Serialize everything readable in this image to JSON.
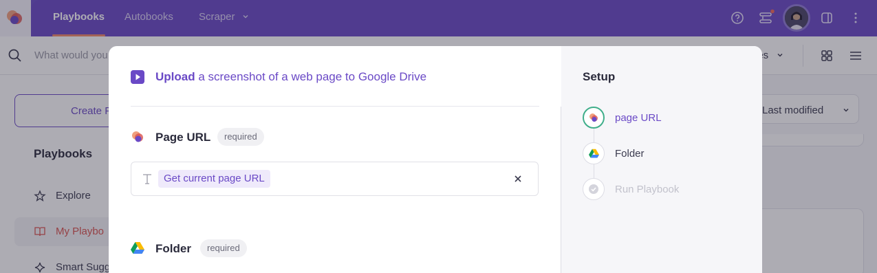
{
  "topnav": {
    "tabs": [
      {
        "label": "Playbooks",
        "active": true
      },
      {
        "label": "Autobooks",
        "active": false
      },
      {
        "label": "Scraper",
        "active": false,
        "has_dropdown": true
      }
    ],
    "icons": [
      "help-icon",
      "workflows-icon",
      "avatar",
      "sidebar-toggle-icon",
      "more-vertical-icon"
    ]
  },
  "background": {
    "search_placeholder": "What would you",
    "filter_label_partial": "ies",
    "create_button_label": "Create P",
    "sidebar_title": "Playbooks",
    "sidebar_items": [
      {
        "label": "Explore",
        "icon": "star-icon"
      },
      {
        "label": "My Playbo",
        "icon": "book-icon"
      },
      {
        "label": "Smart Sugg",
        "icon": "sparkle-icon"
      }
    ],
    "sort_label": "Last modified"
  },
  "modal": {
    "title_strong": "Upload",
    "title_rest": " a screenshot of a web page to Google Drive",
    "fields": [
      {
        "label": "Page URL",
        "badge": "required",
        "value_chip": "Get current page URL"
      },
      {
        "label": "Folder",
        "badge": "required"
      }
    ]
  },
  "setup": {
    "title": "Setup",
    "steps": [
      {
        "label": "page URL",
        "state": "active"
      },
      {
        "label": "Folder",
        "state": "pending"
      },
      {
        "label": "Run Playbook",
        "state": "disabled"
      }
    ]
  },
  "colors": {
    "brand": "#6a49c6",
    "accent": "#f08a6a",
    "active_step": "#3fae8a"
  }
}
